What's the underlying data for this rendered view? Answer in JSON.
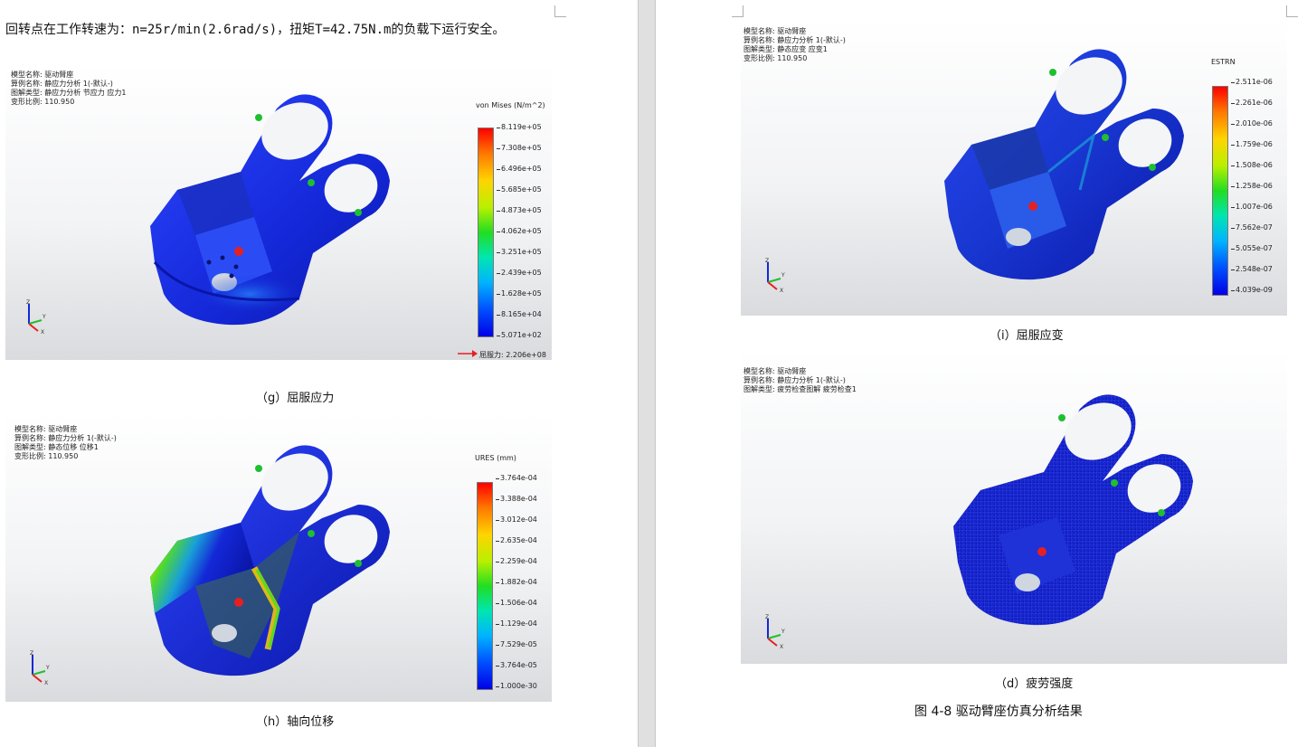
{
  "left_page": {
    "body_text": "回转点在工作转速为：n=25r/min(2.6rad/s)，扭矩T=42.75N.m的负载下运行安全。",
    "panels": [
      {
        "meta": [
          "模型名称: 驱动臂座",
          "算例名称: 静应力分析 1(-默认-)",
          "图解类型: 静应力分析 节应力 应力1",
          "变形比例: 110.950"
        ],
        "legend_title": "von Mises (N/m^2)",
        "ticks": [
          "8.119e+05",
          "7.308e+05",
          "6.496e+05",
          "5.685e+05",
          "4.873e+05",
          "4.062e+05",
          "3.251e+05",
          "2.439e+05",
          "1.628e+05",
          "8.165e+04",
          "5.071e+02"
        ],
        "yield_label": "屈服力: 2.206e+08",
        "caption": "（g）屈服应力"
      },
      {
        "meta": [
          "模型名称: 驱动臂座",
          "算例名称: 静应力分析 1(-默认-)",
          "图解类型: 静态位移 位移1",
          "变形比例: 110.950"
        ],
        "legend_title": "URES (mm)",
        "ticks": [
          "3.764e-04",
          "3.388e-04",
          "3.012e-04",
          "2.635e-04",
          "2.259e-04",
          "1.882e-04",
          "1.506e-04",
          "1.129e-04",
          "7.529e-05",
          "3.764e-05",
          "1.000e-30"
        ],
        "caption": "（h）轴向位移"
      }
    ]
  },
  "right_page": {
    "panels": [
      {
        "meta": [
          "模型名称: 驱动臂座",
          "算例名称: 静应力分析 1(-默认-)",
          "图解类型: 静态应变 应变1",
          "变形比例: 110.950"
        ],
        "legend_title": "ESTRN",
        "ticks": [
          "2.511e-06",
          "2.261e-06",
          "2.010e-06",
          "1.759e-06",
          "1.508e-06",
          "1.258e-06",
          "1.007e-06",
          "7.562e-07",
          "5.055e-07",
          "2.548e-07",
          "4.039e-09"
        ],
        "caption": "（i）屈服应变"
      },
      {
        "meta": [
          "模型名称: 驱动臂座",
          "算例名称: 静应力分析 1(-默认-)",
          "图解类型: 疲劳检查图解 疲劳检查1"
        ],
        "caption": "（d）疲劳强度"
      }
    ],
    "figure_caption": "图 4-8 驱动臂座仿真分析结果"
  },
  "axis_labels": {
    "x": "X",
    "y": "Y",
    "z": "Z"
  },
  "colors": {
    "part_blue": "#1428d8",
    "hot": "#ff2a00",
    "mid": "#22cc22",
    "page": "#ffffff",
    "gutter": "#e0e0e0"
  }
}
